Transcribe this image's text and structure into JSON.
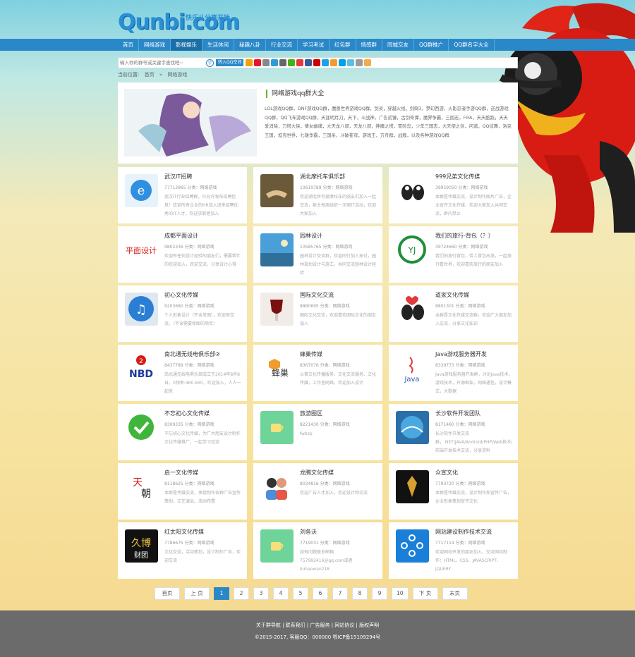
{
  "logo": {
    "text": "Qunbi.com",
    "tagline": "快乐从分享开始"
  },
  "nav": [
    "首页",
    "网络游戏",
    "影视娱乐",
    "生活休闲",
    "秘趣八卦",
    "行业交流",
    "学习考试",
    "红包群",
    "情感群",
    "同城交友",
    "QQ群推广",
    "QQ群名字大全"
  ],
  "search": {
    "placeholder": "输入你的群号或关键字查找吧~",
    "share_label": "转入QQ空间"
  },
  "breadcrumb": [
    "当前位置:",
    "首页",
    "»",
    "网络游戏"
  ],
  "feature": {
    "title": "网络游戏qq群大全",
    "desc": "LOL游戏QQ群，DNF游戏QQ群，魔兽世界游戏QQ群，剑灵，穿越火线，剑网3，梦幻西游，火影忍者手游QQ群，逆战游戏QQ群，QQ飞车游戏QQ群，天涯明月刀，天下，斗战神，广告贰锤，古剑奇谭，魔界争霸，三国志，FIFA，天天酷跑，天天爱消除，刀塔大侠，倩女幽魂，大天龙八部，天龙八部，神魔之塔，冒险岛，少年三国志，大天使之剑，问道，QQ炫舞，洛克王国，坦克世界，七雄争霸，三国杀，斗破苍穹，游戏王，方舟群，战舰，以及各种游戏QQ群"
  },
  "cards": [
    {
      "title": "武汉IT招聘",
      "meta": "77713965 分类：网络游戏",
      "desc": "武汉IT行业招聘群，只允许发布招聘信息！欢迎所有企业的HR加入进来招聘优秀的IT人才，欢迎求职者加入"
    },
    {
      "title": "湖北摩托车俱乐部",
      "meta": "10619789 分类：网络游戏",
      "desc": "欢迎湖北所有爱摩托车的骑友们加入一起交流，群主每周组织一次骑行活动，欢迎大家加入"
    },
    {
      "title": "999兄弟文化传媒",
      "meta": "39959050 分类：网络游戏",
      "desc": "本群是传媒交流，设计制作图片广告，企业宣传文化传媒，欢迎大家加入共同交流，群内禁止"
    },
    {
      "title": "成都平面设计",
      "meta": "9802336 分类：网络游戏",
      "desc": "欢迎有任何设计经验的朋友们，需要帮忙的欢迎加入，欢迎交流，分享设计心得"
    },
    {
      "title": "园林设计",
      "meta": "10585765 分类：网络游戏",
      "desc": "园林设计交流群，欢迎同行加入探讨，园林规划设计与施工，共同交流园林设计经验"
    },
    {
      "title": "我们的旅行-背包（？）",
      "meta": "39724660 分类：网络游戏",
      "desc": "我们的旅行背包，带上背包出发，一起旅行看世界，欢迎喜欢旅行的朋友加入"
    },
    {
      "title": "初心文化传媒",
      "meta": "9203680 分类：网络游戏",
      "desc": "个人形象设计（不含单图），欢迎来交流，（不含需要修图的项目）"
    },
    {
      "title": "国际文化交流",
      "meta": "8880695 分类：网络游戏",
      "desc": "国际文化交流，欢迎喜欢国际文化的朋友加入"
    },
    {
      "title": "道家文化传媒",
      "meta": "8801301 分类：网络游戏",
      "desc": "本群是文化传媒交流群，欢迎广大朋友加入交流，分享文化知识"
    },
    {
      "title": "南北通无线电俱乐部②",
      "meta": "8437789 分类：网络游戏",
      "desc": "南北通无线电俱乐部成立于2014年8月8日，0频率:460.650，欢迎加入，人人一起来"
    },
    {
      "title": "蜂巢传媒",
      "meta": "8367076 分类：网络游戏",
      "desc": "从事文化传播服务、文化交流服务、文化传媒，工作室网络，欢迎加入设计"
    },
    {
      "title": "Java游戏服务器开发",
      "meta": "8339773 分类：网络游戏",
      "desc": "Java游戏服务器开发群，讨论Java技术，游戏技术，开源框架，网络通信，设计模式，大数据"
    },
    {
      "title": "不忘初心文化传媒",
      "meta": "8309335 分类：网络游戏",
      "desc": "不忘初心文化传媒，为广大朋友设计制作文化传媒推广，一起学习交流"
    },
    {
      "title": "旅游圈区",
      "meta": "8221430 分类：网络游戏",
      "desc": "fwbsp"
    },
    {
      "title": "长沙软件开发团队",
      "meta": "8171460 分类：网络游戏",
      "desc": "长沙软件开发交流群，.NET/JAVA/Android/PHP/Web技术/前端开发技术交流，分享资料"
    },
    {
      "title": "启一文化传媒",
      "meta": "8118625 分类：网络游戏",
      "desc": "本群是传媒交流，承接制作各种广告宣传策划，文艺演出，活动布置"
    },
    {
      "title": "龙腾文化传媒",
      "meta": "8034816 分类：网络游戏",
      "desc": "欢迎广告人才加入，欢迎设计师交流"
    },
    {
      "title": "众宣文化",
      "meta": "7793720 分类：网络游戏",
      "desc": "本群是传媒交流，设计制作和宣传广告，企业形象策划宣传文化"
    },
    {
      "title": "红太阳文化传媒",
      "meta": "7786675 分类：网络游戏",
      "desc": "文化交流，活动策划，设计制作广告，欢迎交流"
    },
    {
      "title": "刘各沃",
      "meta": "7719031 分类：网络游戏",
      "desc": "如有问题联系邮箱757992416@qq.com或者liuhaowan218"
    },
    {
      "title": "网站建设制作技术交流",
      "meta": "7717114 分类：网络游戏",
      "desc": "欢迎网站开发的朋友加入，交流网站制作：HTML、CSS、JAVASCRIPT、JQUERY"
    }
  ],
  "pager": [
    "首页",
    "上 页",
    "1",
    "2",
    "3",
    "4",
    "5",
    "6",
    "7",
    "8",
    "9",
    "10",
    "下 页",
    "末页"
  ],
  "footer": {
    "links": "关于群导航 | 联系我们 | 广告服务 | 网站协议 | 版权声明",
    "copyright": "©2015-2017, 客服QQ：000000 鄂ICP备15109294号"
  },
  "colors": {
    "nav_bg": "#2a88c9",
    "accent_green": "#6bb52f",
    "footer_bg": "#6b6b6b"
  }
}
